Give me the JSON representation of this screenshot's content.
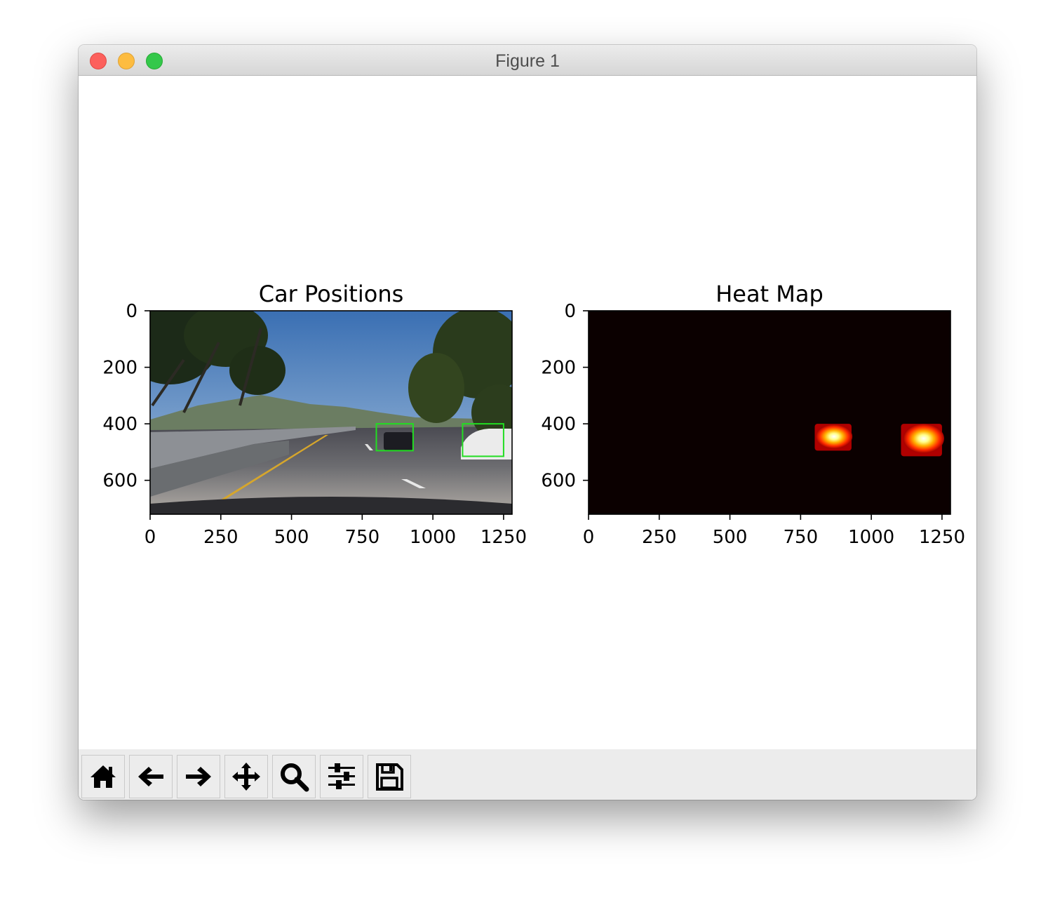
{
  "window": {
    "title": "Figure 1",
    "controls": [
      "close",
      "minimize",
      "zoom"
    ]
  },
  "toolbar": {
    "buttons": [
      {
        "icon": "home-icon",
        "action": "home"
      },
      {
        "icon": "arrow-left-icon",
        "action": "back"
      },
      {
        "icon": "arrow-right-icon",
        "action": "forward"
      },
      {
        "icon": "pan-icon",
        "action": "pan"
      },
      {
        "icon": "zoom-icon",
        "action": "zoom"
      },
      {
        "icon": "sliders-icon",
        "action": "configure-subplots"
      },
      {
        "icon": "save-icon",
        "action": "save"
      }
    ]
  },
  "chart_data": [
    {
      "type": "image",
      "title": "Car Positions",
      "xlim": [
        0,
        1280
      ],
      "ylim": [
        720,
        0
      ],
      "xticks": [
        0,
        250,
        500,
        750,
        1000,
        1250
      ],
      "yticks": [
        0,
        200,
        400,
        600
      ],
      "grid": false,
      "annotations": [
        {
          "kind": "bounding-box",
          "color": "#22dd22",
          "x0": 800,
          "x1": 930,
          "y0": 400,
          "y1": 495
        },
        {
          "kind": "bounding-box",
          "color": "#22dd22",
          "x0": 1105,
          "x1": 1250,
          "y0": 400,
          "y1": 515
        }
      ]
    },
    {
      "type": "heatmap",
      "title": "Heat Map",
      "colormap": "hot",
      "xlim": [
        0,
        1280
      ],
      "ylim": [
        720,
        0
      ],
      "xticks": [
        0,
        250,
        500,
        750,
        1000,
        1250
      ],
      "yticks": [
        0,
        200,
        400,
        600
      ],
      "grid": false,
      "hot_regions": [
        {
          "x0": 800,
          "x1": 930,
          "y0": 400,
          "y1": 495,
          "peak_x": 868,
          "peak_y": 445
        },
        {
          "x0": 1105,
          "x1": 1250,
          "y0": 400,
          "y1": 515,
          "peak_x": 1185,
          "peak_y": 452
        }
      ]
    }
  ]
}
